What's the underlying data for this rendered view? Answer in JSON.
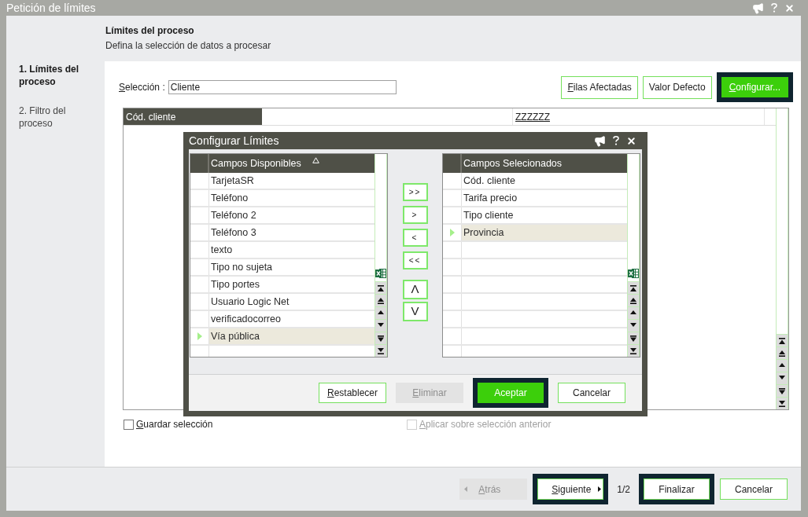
{
  "window": {
    "title": "Petición de límites"
  },
  "header": {
    "title": "Límites del proceso",
    "subtitle": "Defina la selección de datos a procesar"
  },
  "steps": [
    {
      "label": "1. Límites del proceso",
      "selected": true
    },
    {
      "label": "2. Filtro del proceso",
      "selected": false
    }
  ],
  "selection": {
    "label": "Selección :",
    "value": "Cliente",
    "underlined_initial": true
  },
  "toolbar_buttons": [
    {
      "label": "Filas Afectadas",
      "underlined_initial": true,
      "primary": false,
      "focused": false
    },
    {
      "label": "Valor Defecto",
      "primary": false,
      "focused": false
    },
    {
      "label": "Configurar...",
      "underlined_initial": true,
      "primary": true,
      "focused": true
    }
  ],
  "limits_grid": {
    "rows": [
      {
        "field": "Cód. cliente",
        "to": "ZZZZZZ"
      }
    ]
  },
  "options": [
    {
      "label": "Guardar selección",
      "underlined_initial": true,
      "checked": false,
      "disabled": false
    },
    {
      "label": "Aplicar sobre selección anterior",
      "underlined_initial": true,
      "checked": false,
      "disabled": true
    }
  ],
  "dialog": {
    "title": "Configurar Límites",
    "available": {
      "heading": "Campos Disponibles",
      "sorted": true,
      "rows": [
        {
          "label": "TarjetaSR",
          "selected": false
        },
        {
          "label": "Teléfono",
          "selected": false
        },
        {
          "label": "Teléfono 2",
          "selected": false
        },
        {
          "label": "Teléfono 3",
          "selected": false
        },
        {
          "label": "texto",
          "selected": false
        },
        {
          "label": "Tipo no sujeta",
          "selected": false
        },
        {
          "label": "Tipo portes",
          "selected": false
        },
        {
          "label": "Usuario Logic Net",
          "selected": false
        },
        {
          "label": "verificadocorreo",
          "selected": false
        },
        {
          "label": "Vía pública",
          "selected": true
        }
      ]
    },
    "move_buttons": [
      {
        "kind": "transfer",
        "label": ">>"
      },
      {
        "kind": "transfer",
        "label": ">"
      },
      {
        "kind": "transfer",
        "label": "<"
      },
      {
        "kind": "transfer",
        "label": "<<"
      },
      {
        "kind": "reorder",
        "label": "Λ"
      },
      {
        "kind": "reorder",
        "label": "V"
      }
    ],
    "selected_fields": {
      "heading": "Campos Selecionados",
      "rows": [
        {
          "label": "Cód. cliente",
          "selected": false
        },
        {
          "label": "Tarifa precio",
          "selected": false
        },
        {
          "label": "Tipo cliente",
          "selected": false
        },
        {
          "label": "Provincia",
          "selected": true
        }
      ]
    },
    "buttons": [
      {
        "label": "Restablecer",
        "underlined_initial": true,
        "primary": false,
        "focused": false,
        "disabled": false
      },
      {
        "label": "Eliminar",
        "underlined_initial": true,
        "primary": false,
        "focused": false,
        "disabled": true
      },
      {
        "label": "Aceptar",
        "primary": true,
        "focused": true,
        "disabled": false
      },
      {
        "label": "Cancelar",
        "primary": false,
        "focused": false,
        "disabled": false
      }
    ]
  },
  "footer": {
    "items": [
      {
        "kind": "back",
        "label": "Atrás",
        "underlined_initial": true,
        "disabled": true,
        "focused": false
      },
      {
        "kind": "next",
        "label": "Siguiente",
        "underlined_initial": true,
        "disabled": false,
        "focused": true
      },
      {
        "kind": "page",
        "text": "1/2"
      },
      {
        "kind": "button",
        "label": "Finalizar",
        "disabled": false,
        "focused": true
      },
      {
        "kind": "button",
        "label": "Cancelar",
        "disabled": false,
        "focused": false
      }
    ]
  }
}
